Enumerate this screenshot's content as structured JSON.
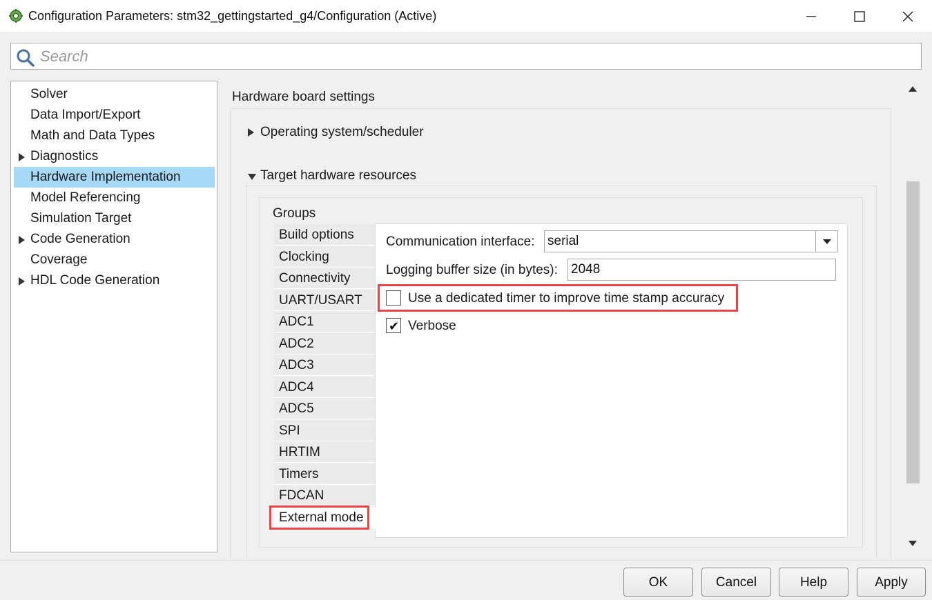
{
  "window": {
    "title": "Configuration Parameters: stm32_gettingstarted_g4/Configuration (Active)",
    "icon": "gear-icon"
  },
  "search": {
    "placeholder": "Search"
  },
  "tree": {
    "items": [
      {
        "label": "Solver",
        "expandable": false,
        "selected": false
      },
      {
        "label": "Data Import/Export",
        "expandable": false,
        "selected": false
      },
      {
        "label": "Math and Data Types",
        "expandable": false,
        "selected": false
      },
      {
        "label": "Diagnostics",
        "expandable": true,
        "selected": false
      },
      {
        "label": "Hardware Implementation",
        "expandable": false,
        "selected": true
      },
      {
        "label": "Model Referencing",
        "expandable": false,
        "selected": false
      },
      {
        "label": "Simulation Target",
        "expandable": false,
        "selected": false
      },
      {
        "label": "Code Generation",
        "expandable": true,
        "selected": false
      },
      {
        "label": "Coverage",
        "expandable": false,
        "selected": false
      },
      {
        "label": "HDL Code Generation",
        "expandable": true,
        "selected": false
      }
    ]
  },
  "main": {
    "section_title": "Hardware board settings",
    "os_scheduler": {
      "label": "Operating system/scheduler",
      "expanded": false
    },
    "target_resources": {
      "label": "Target hardware resources",
      "expanded": true
    },
    "groups": {
      "label": "Groups",
      "tabs": [
        "Build options",
        "Clocking",
        "Connectivity",
        "UART/USART",
        "ADC1",
        "ADC2",
        "ADC3",
        "ADC4",
        "ADC5",
        "SPI",
        "HRTIM",
        "Timers",
        "FDCAN",
        "External mode"
      ],
      "active_tab": "External mode"
    },
    "external_mode": {
      "comm_interface_label": "Communication interface:",
      "comm_interface_value": "serial",
      "logging_buffer_label": "Logging buffer size (in bytes):",
      "logging_buffer_value": "2048",
      "dedicated_timer_label": "Use a dedicated timer to improve time stamp accuracy",
      "dedicated_timer_checked": false,
      "verbose_label": "Verbose",
      "verbose_checked": true
    }
  },
  "footer": {
    "ok": "OK",
    "cancel": "Cancel",
    "help": "Help",
    "apply": "Apply"
  },
  "colors": {
    "selection": "#a6d8f8",
    "highlight": "#e8454a"
  }
}
